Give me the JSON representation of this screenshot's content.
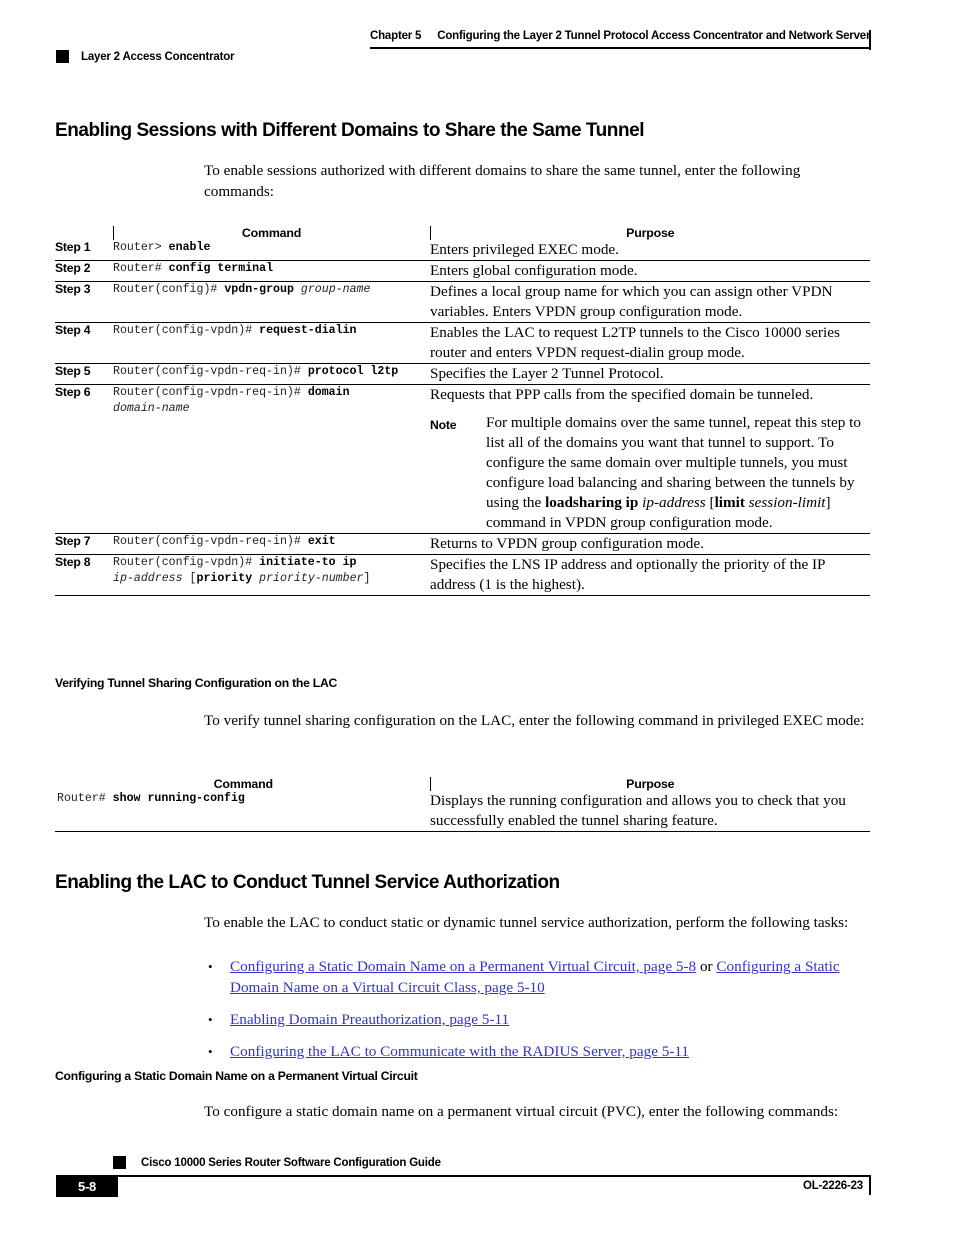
{
  "header": {
    "chapter_label": "Chapter 5",
    "chapter_title": "Configuring the Layer 2 Tunnel Protocol Access Concentrator and Network Server",
    "section_label": "Layer 2 Access Concentrator"
  },
  "section1": {
    "heading": "Enabling Sessions with Different Domains to Share the Same Tunnel",
    "intro": "To enable sessions authorized with different domains to share the same tunnel, enter the following commands:",
    "table": {
      "col_step_header": "",
      "col_command_header": "Command",
      "col_purpose_header": "Purpose",
      "rows": [
        {
          "step": "Step 1",
          "cmd_prompt": "Router> ",
          "cmd_bold": "enable",
          "cmd_arg": "",
          "cmd_line2": "",
          "purpose": "Enters privileged EXEC mode."
        },
        {
          "step": "Step 2",
          "cmd_prompt": "Router# ",
          "cmd_bold": "config terminal",
          "cmd_arg": "",
          "cmd_line2": "",
          "purpose": "Enters global configuration mode."
        },
        {
          "step": "Step 3",
          "cmd_prompt": "Router(config)# ",
          "cmd_bold": "vpdn-group",
          "cmd_arg": "group-name",
          "cmd_line2": "",
          "purpose": "Defines a local group name for which you can assign other VPDN variables. Enters VPDN group configuration mode."
        },
        {
          "step": "Step 4",
          "cmd_prompt": "Router(config-vpdn)# ",
          "cmd_bold": "request-dialin",
          "cmd_arg": "",
          "cmd_line2": "",
          "purpose": "Enables the LAC to request L2TP tunnels to the Cisco 10000 series router and enters VPDN request-dialin group mode."
        },
        {
          "step": "Step 5",
          "cmd_prompt": "Router(config-vpdn-req-in)# ",
          "cmd_bold": "protocol l2tp",
          "cmd_arg": "",
          "cmd_line2": "",
          "purpose": "Specifies the Layer 2 Tunnel Protocol."
        },
        {
          "step": "Step 6",
          "cmd_prompt": "Router(config-vpdn-req-in)# ",
          "cmd_bold": "domain",
          "cmd_arg": "",
          "cmd_line2": "domain-name",
          "purpose": "Requests that PPP calls from the specified domain be tunneled.",
          "note_label": "Note",
          "note_text_1": "For multiple domains over the same tunnel, repeat this step to list all of the domains you want that tunnel to support. To configure the same domain over multiple tunnels, you must configure load balancing and sharing between the tunnels by using the ",
          "note_bold_1": "loadsharing ip",
          "note_italic_1": "ip-address",
          "note_bracket_open": "[",
          "note_bold_2": "limit",
          "note_italic_2": "session-limit",
          "note_bracket_close": "]",
          "note_text_2": " command in VPDN group configuration mode."
        },
        {
          "step": "Step 7",
          "cmd_prompt": "Router(config-vpdn-req-in)# ",
          "cmd_bold": "exit",
          "cmd_arg": "",
          "cmd_line2": "",
          "purpose": "Returns to VPDN group configuration mode."
        },
        {
          "step": "Step 8",
          "cmd_prompt": "Router(config-vpdn)# ",
          "cmd_bold": "initiate-to ip",
          "cmd_arg": "",
          "cmd_line2_italic": "ip-address",
          "cmd_line2_bracket_open": " [",
          "cmd_line2_bold": "priority",
          "cmd_line2_italic2": "priority-number",
          "cmd_line2_bracket_close": "]",
          "purpose": "Specifies the LNS IP address and optionally the priority of the IP address (1 is the highest)."
        }
      ]
    }
  },
  "section2": {
    "heading": "Verifying Tunnel Sharing Configuration on the LAC",
    "intro": "To verify tunnel sharing configuration on the LAC, enter the following command in privileged EXEC mode:",
    "table": {
      "col_command_header": "Command",
      "col_purpose_header": "Purpose",
      "row": {
        "cmd_prompt": "Router# ",
        "cmd_bold": "show running-config",
        "purpose": "Displays the running configuration and allows you to check that you successfully enabled the tunnel sharing feature."
      }
    }
  },
  "section3": {
    "heading": "Enabling the LAC to Conduct Tunnel Service Authorization",
    "intro": "To enable the LAC to conduct static or dynamic tunnel service authorization, perform the following tasks:",
    "bullets": [
      {
        "link1": "Configuring a Static Domain Name on a Permanent Virtual Circuit, page 5-8",
        "conj": " or ",
        "link2": "Configuring a Static Domain Name on a Virtual Circuit Class, page 5-10"
      },
      {
        "link1": "Enabling Domain Preauthorization, page 5-11",
        "conj": "",
        "link2": ""
      },
      {
        "link1": "Configuring the LAC to Communicate with the RADIUS Server, page 5-11",
        "conj": "",
        "link2": ""
      }
    ],
    "bullet_marker": "•"
  },
  "section4": {
    "heading": "Configuring a Static Domain Name on a Permanent Virtual Circuit",
    "intro": "To configure a static domain name on a permanent virtual circuit (PVC), enter the following commands:"
  },
  "footer": {
    "guide_title": "Cisco 10000 Series Router Software Configuration Guide",
    "page_number": "5-8",
    "doc_number": "OL-2226-23"
  },
  "colors": {
    "link": "#3333cc",
    "rule": "#000000"
  }
}
